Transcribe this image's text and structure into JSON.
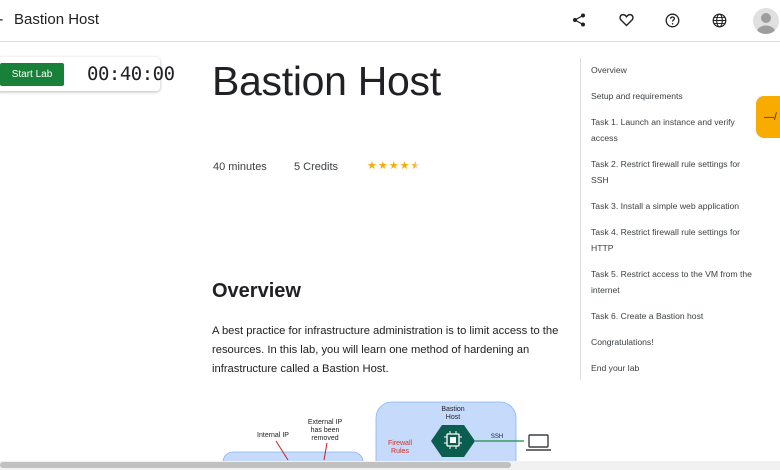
{
  "header": {
    "back_arrow": "-",
    "title": "Bastion Host",
    "icons": [
      "share-icon",
      "heart-icon",
      "help-icon",
      "globe-icon",
      "account-avatar"
    ]
  },
  "lab_panel": {
    "start_label": "Start Lab",
    "timer": "00:40:00"
  },
  "main": {
    "title": "Bastion Host",
    "duration": "40 minutes",
    "credits": "5 Credits",
    "rating": 4.5,
    "section_heading": "Overview",
    "paragraph": "A best practice for infrastructure administration is to limit access to the resources. In this lab, you will learn one method of hardening an infrastructure called a Bastion Host."
  },
  "diagram": {
    "internal_ip": "Internal IP",
    "external_ip_lines": [
      "External IP",
      "has been",
      "removed"
    ],
    "bastion_lines": [
      "Bastion",
      "Host"
    ],
    "firewall_lines": [
      "Firewall",
      "Rules"
    ],
    "ssh": "SSH"
  },
  "toc": {
    "items": [
      "Overview",
      "Setup and requirements",
      "Task 1. Launch an instance and verify access",
      "Task 2. Restrict firewall rule settings for SSH",
      "Task 3. Install a simple web application",
      "Task 4. Restrict firewall rule settings for HTTP",
      "Task 5. Restrict access to the VM from the internet",
      "Task 6. Create a Bastion host",
      "Congratulations!",
      "End your lab"
    ]
  },
  "floating_tab": {
    "label": "—/"
  },
  "colors": {
    "start_button": "#188038",
    "star": "#f9ab00",
    "floating_tab": "#f9ab00",
    "diagram_box": "#c6dafc",
    "hexagon": "#0b5d4f",
    "ssh_line": "#1e8e3e",
    "firewall_text": "#d93025"
  }
}
